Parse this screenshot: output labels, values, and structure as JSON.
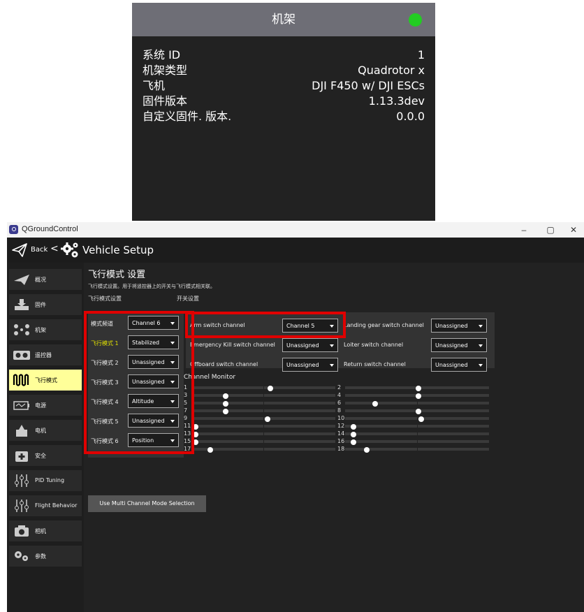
{
  "popup": {
    "title": "机架",
    "status_color": "#22cc22",
    "rows": [
      {
        "label": "系统 ID",
        "value": "1"
      },
      {
        "label": "机架类型",
        "value": "Quadrotor x"
      },
      {
        "label": "飞机",
        "value": "DJI F450 w/ DJI ESCs"
      },
      {
        "label": "固件版本",
        "value": "1.13.3dev"
      },
      {
        "label": "自定义固件. 版本.",
        "value": "0.0.0"
      }
    ]
  },
  "window": {
    "title": "QGroundControl",
    "controls": {
      "minimize": "–",
      "maximize": "▢",
      "close": "✕"
    }
  },
  "toolbar": {
    "back": "Back",
    "separator": "<",
    "title": "Vehicle Setup"
  },
  "sidebar": {
    "items": [
      {
        "label": "概况",
        "icon": "plane-icon"
      },
      {
        "label": "固件",
        "icon": "firmware-download-icon"
      },
      {
        "label": "机架",
        "icon": "airframe-icon"
      },
      {
        "label": "遥控器",
        "icon": "radio-icon"
      },
      {
        "label": "飞行模式",
        "icon": "flight-modes-icon",
        "active": true
      },
      {
        "label": "电源",
        "icon": "battery-icon"
      },
      {
        "label": "电机",
        "icon": "motor-icon"
      },
      {
        "label": "安全",
        "icon": "safety-icon"
      },
      {
        "label": "PID Tuning",
        "icon": "sliders-icon"
      },
      {
        "label": "Flight Behavior",
        "icon": "sliders-icon"
      },
      {
        "label": "相机",
        "icon": "camera-icon"
      },
      {
        "label": "参数",
        "icon": "parameters-icon"
      }
    ]
  },
  "main": {
    "title": "飞行模式 设置",
    "description": "飞行模式设置。用于将遥控器上的开关与飞行模式相关联。",
    "modes_header": "飞行模式设置",
    "switches_header": "开关设置",
    "mode_channel": {
      "label": "模式频道",
      "value": "Channel 6"
    },
    "modes": [
      {
        "label": "飞行模式 1",
        "value": "Stabilized",
        "highlight": true
      },
      {
        "label": "飞行模式 2",
        "value": "Unassigned"
      },
      {
        "label": "飞行模式 3",
        "value": "Unassigned"
      },
      {
        "label": "飞行模式 4",
        "value": "Altitude"
      },
      {
        "label": "飞行模式 5",
        "value": "Unassigned"
      },
      {
        "label": "飞行模式 6",
        "value": "Position"
      }
    ],
    "switches": [
      {
        "label": "Arm switch channel",
        "value": "Channel 5"
      },
      {
        "label": "Emergency Kill switch channel",
        "value": "Unassigned"
      },
      {
        "label": "Offboard switch channel",
        "value": "Unassigned"
      },
      {
        "label": "Landing gear switch channel",
        "value": "Unassigned"
      },
      {
        "label": "Loiter switch channel",
        "value": "Unassigned"
      },
      {
        "label": "Return switch channel",
        "value": "Unassigned"
      }
    ],
    "channel_monitor": {
      "title": "Channel Monitor",
      "channels": [
        {
          "label": "1",
          "value": 0.55
        },
        {
          "label": "2",
          "value": 0.51
        },
        {
          "label": "3",
          "value": 0.24
        },
        {
          "label": "4",
          "value": 0.51
        },
        {
          "label": "5",
          "value": 0.24
        },
        {
          "label": "6",
          "value": 0.21
        },
        {
          "label": "7",
          "value": 0.24
        },
        {
          "label": "8",
          "value": 0.51
        },
        {
          "label": "9",
          "value": 0.53
        },
        {
          "label": "10",
          "value": 0.53
        },
        {
          "label": "11",
          "value": 0.03
        },
        {
          "label": "12",
          "value": 0.06
        },
        {
          "label": "13",
          "value": 0.03
        },
        {
          "label": "14",
          "value": 0.06
        },
        {
          "label": "15",
          "value": 0.03
        },
        {
          "label": "16",
          "value": 0.06
        },
        {
          "label": "17",
          "value": 0.13
        },
        {
          "label": "18",
          "value": 0.15
        }
      ]
    },
    "multi_channel_button": "Use Multi Channel Mode Selection"
  },
  "colors": {
    "highlight_box": "#e00000",
    "active_tab": "#ffff99",
    "mode_highlight": "#e0e000"
  }
}
